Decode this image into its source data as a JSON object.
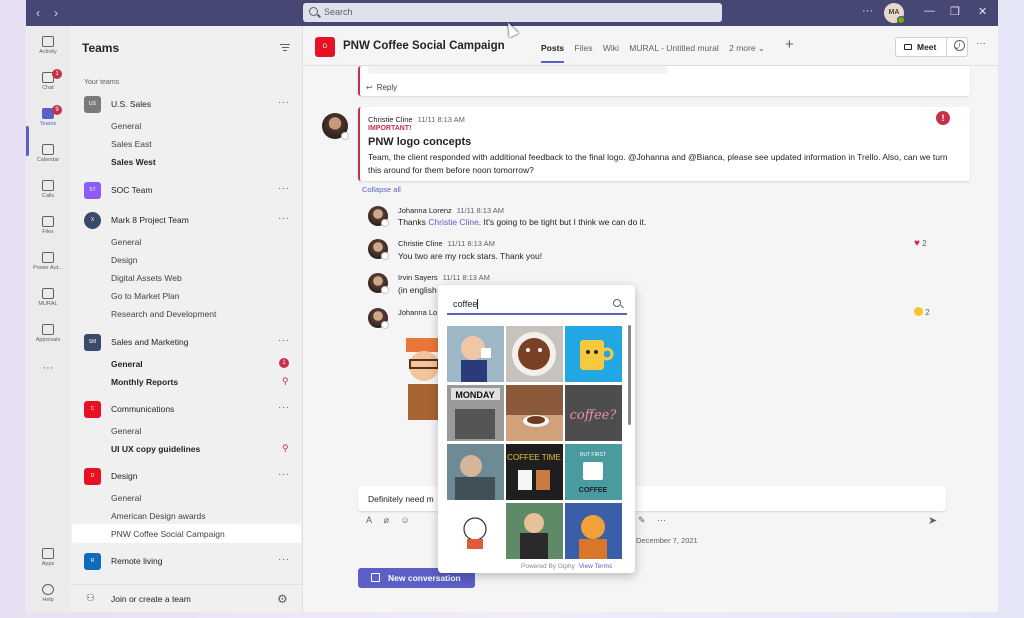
{
  "titlebar": {
    "search_placeholder": "Search",
    "more": "···",
    "avatar_initials": "MA",
    "min": "—",
    "restore": "❐",
    "close": "✕"
  },
  "rail": [
    {
      "label": "Activity"
    },
    {
      "label": "Chat",
      "badge": "1"
    },
    {
      "label": "Teams",
      "badge": "9"
    },
    {
      "label": "Calendar"
    },
    {
      "label": "Calls"
    },
    {
      "label": "Files"
    },
    {
      "label": "Power Aut..."
    },
    {
      "label": "MURAL"
    },
    {
      "label": "Approvals"
    },
    {
      "label": "Apps"
    },
    {
      "label": "Help"
    }
  ],
  "rail_more": "···",
  "panel": {
    "title": "Teams",
    "your_teams": "Your teams",
    "join": "Join or create a team"
  },
  "teams": [
    {
      "name": "U.S. Sales",
      "abbr": "US",
      "color": "#7a7a7a",
      "channels": [
        "General",
        "Sales East",
        "Sales West"
      ]
    },
    {
      "name": "SOC Team",
      "abbr": "ST",
      "color": "#8b5cf6"
    },
    {
      "name": "Mark 8 Project Team",
      "abbr": "X",
      "color": "#3a4a6b",
      "channels": [
        "General",
        "Design",
        "Digital Assets Web",
        "Go to Market Plan",
        "Research and Development"
      ]
    },
    {
      "name": "Sales and Marketing",
      "abbr": "SM",
      "color": "#3a4a6b",
      "channels": [
        "General",
        "Monthly Reports"
      ],
      "badge": "1"
    },
    {
      "name": "Communications",
      "abbr": "C",
      "color": "#e81123",
      "channels": [
        "General",
        "UI UX copy guidelines"
      ]
    },
    {
      "name": "Design",
      "abbr": "D",
      "color": "#e81123",
      "channels": [
        "General",
        "American Design awards",
        "PNW Coffee Social Campaign"
      ]
    },
    {
      "name": "Remote living",
      "abbr": "R",
      "color": "#0f6cbd"
    }
  ],
  "channel": {
    "avatar": "D",
    "title": "PNW Coffee Social Campaign",
    "tabs": [
      "Posts",
      "Files",
      "Wiki",
      "MURAL - Untitled mural",
      "2 more ⌄"
    ],
    "meet": "Meet"
  },
  "thread": {
    "reply": "Reply",
    "post": {
      "author": "Christie Cline",
      "time": "11/11 8:13 AM",
      "important": "IMPORTANT!",
      "subject": "PNW logo concepts",
      "body": "Team, the client responded with additional feedback to the final logo. @Johanna and @Bianca, please see updated information in Trello. Also, can we turn this around for them before noon tomorrow?"
    },
    "collapse": "Collapse all",
    "replies": [
      {
        "author": "Johanna Lorenz",
        "time": "11/11 8:13 AM",
        "pre": "Thanks ",
        "mention": "Christie Cline",
        "post": ". It's going to be tight but I think we can do it."
      },
      {
        "author": "Christie Cline",
        "time": "11/11 8:13 AM",
        "text": "You two are my rock stars. Thank you!",
        "reaction": "2"
      },
      {
        "author": "Irvin Sayers",
        "time": "11/11 8:13 AM",
        "text": "(in english"
      },
      {
        "author": "Johanna Lo",
        "reaction": "2"
      }
    ],
    "compose_text": "Definitely need m",
    "date": "December 7, 2021",
    "new_conversation": "New conversation"
  },
  "giphy": {
    "query": "coffee",
    "powered": "Powered By Giphy",
    "terms": "View Terms",
    "gifs": [
      "Spilled Coffee",
      "Coffee Cup",
      "Mug Face",
      "Monday",
      "Coffee Table",
      "Coffee?",
      "Old Movie",
      "Coffee Time",
      "But First Coffee",
      "Cat Sketch",
      "Man Drinking",
      "Cartoon"
    ]
  }
}
